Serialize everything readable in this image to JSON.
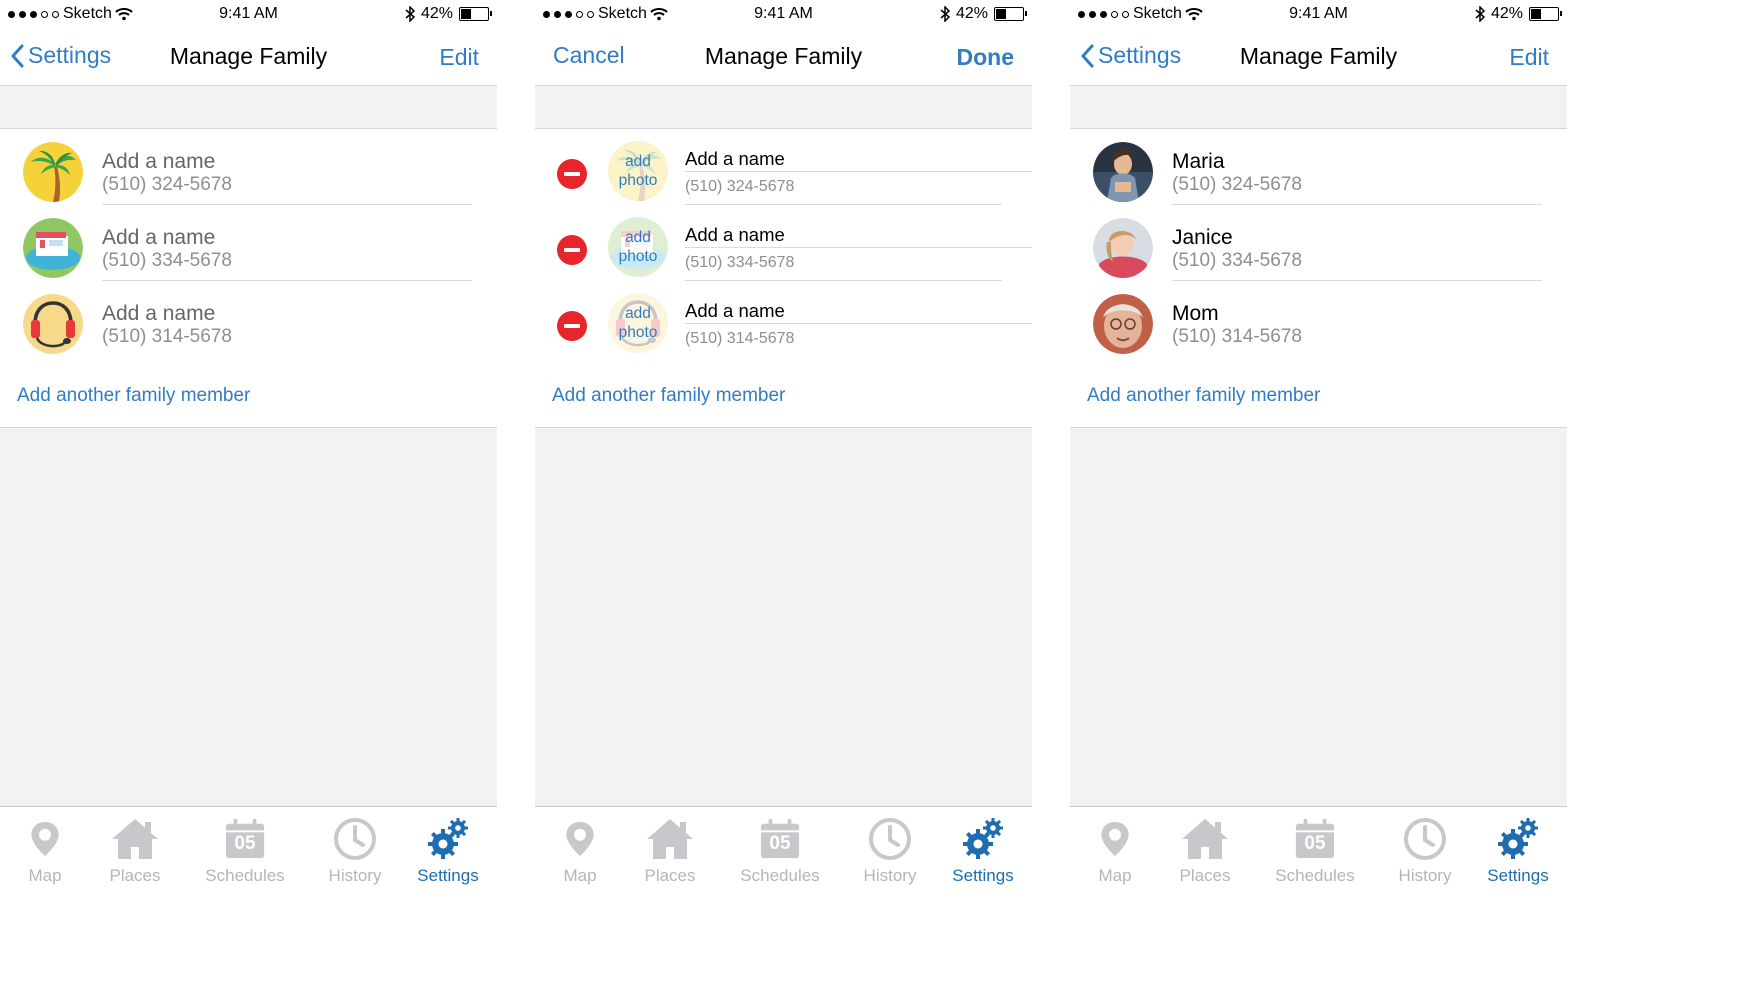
{
  "status_bar": {
    "carrier": "Sketch",
    "time": "9:41 AM",
    "battery": "42%",
    "battery_level": 0.42
  },
  "screens": [
    {
      "nav": {
        "left": "Settings",
        "title": "Manage Family",
        "right": "Edit"
      },
      "rows": [
        {
          "name": "Add a name",
          "phone": "(510) 324-5678",
          "avatar": "palm-tree-icon"
        },
        {
          "name": "Add a name",
          "phone": "(510) 334-5678",
          "avatar": "pool-icon"
        },
        {
          "name": "Add a name",
          "phone": "(510) 314-5678",
          "avatar": "headphones-icon"
        }
      ],
      "add_member": "Add another family member"
    },
    {
      "nav": {
        "left": "Cancel",
        "title": "Manage Family",
        "right": "Done"
      },
      "rows": [
        {
          "name": "Add a name",
          "phone": "(510) 324-5678",
          "photo_label_1": "add",
          "photo_label_2": "photo"
        },
        {
          "name": "Add a name",
          "phone": "(510) 334-5678",
          "photo_label_1": "add",
          "photo_label_2": "photo"
        },
        {
          "name": "Add a name",
          "phone": "(510) 314-5678",
          "photo_label_1": "add",
          "photo_label_2": "photo"
        }
      ],
      "add_member": "Add another family member"
    },
    {
      "nav": {
        "left": "Settings",
        "title": "Manage Family",
        "right": "Edit"
      },
      "rows": [
        {
          "name": "Maria",
          "phone": "(510) 324-5678",
          "avatar": "photo-maria"
        },
        {
          "name": "Janice",
          "phone": "(510) 334-5678",
          "avatar": "photo-janice"
        },
        {
          "name": "Mom",
          "phone": "(510) 314-5678",
          "avatar": "photo-mom"
        }
      ],
      "add_member": "Add another family member"
    }
  ],
  "tabs": [
    {
      "label": "Map",
      "icon": "map-pin-icon"
    },
    {
      "label": "Places",
      "icon": "house-icon"
    },
    {
      "label": "Schedules",
      "icon": "calendar-icon",
      "icon_text": "05"
    },
    {
      "label": "History",
      "icon": "clock-icon"
    },
    {
      "label": "Settings",
      "icon": "gears-icon",
      "active": true
    }
  ],
  "colors": {
    "accent": "#2f7dc4",
    "delete_red": "#e8252b",
    "inactive_tab": "#b5b5ba",
    "active_tab": "#1e6db0",
    "background": "#f2f2f4"
  }
}
